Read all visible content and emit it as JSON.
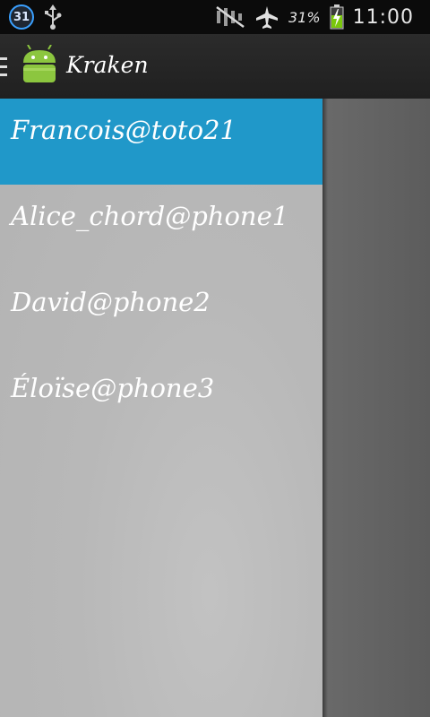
{
  "status_bar": {
    "calendar_day": "31",
    "battery_percent": "31%",
    "time": "11:00",
    "icons": [
      "calendar-icon",
      "usb-icon",
      "no-signal-icon",
      "airplane-mode-icon",
      "battery-charging-icon"
    ]
  },
  "action_bar": {
    "title": "Kraken",
    "icons": [
      "drawer-indicator-icon",
      "android-logo-icon"
    ]
  },
  "drawer": {
    "items": [
      {
        "label": "Francois@toto21",
        "selected": true
      },
      {
        "label": "Alice_chord@phone1",
        "selected": false
      },
      {
        "label": "David@phone2",
        "selected": false
      },
      {
        "label": "Éloïse@phone3",
        "selected": false
      }
    ]
  },
  "colors": {
    "selected_item": "#2098c9",
    "drawer_background": "#b8b8b8",
    "action_bar": "#222222",
    "status_bar": "#0b0b0b",
    "dimmed_content": "#626262"
  }
}
